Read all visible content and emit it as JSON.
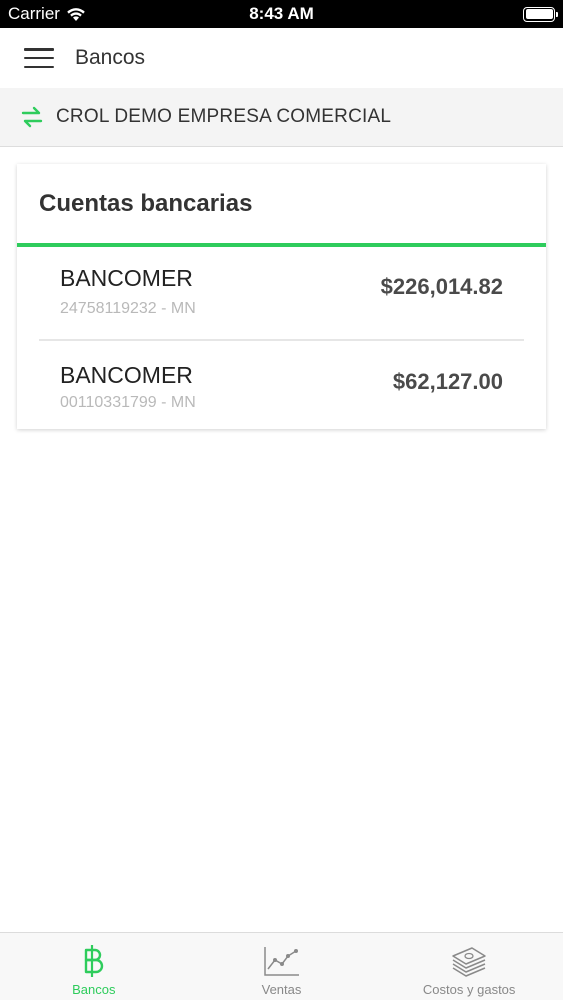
{
  "status_bar": {
    "carrier": "Carrier",
    "time": "8:43 AM"
  },
  "app_bar": {
    "title": "Bancos"
  },
  "company": {
    "name": "CROL DEMO EMPRESA COMERCIAL"
  },
  "card": {
    "title": "Cuentas bancarias",
    "accounts": [
      {
        "bank": "BANCOMER",
        "number": "24758119232 - MN",
        "amount": "$226,014.82"
      },
      {
        "bank": "BANCOMER",
        "number": "00110331799 - MN",
        "amount": "$62,127.00"
      }
    ]
  },
  "tab_bar": {
    "tabs": [
      {
        "label": "Bancos",
        "icon": "baht-icon",
        "active": true
      },
      {
        "label": "Ventas",
        "icon": "line-chart-icon",
        "active": false
      },
      {
        "label": "Costos y gastos",
        "icon": "money-stack-icon",
        "active": false
      }
    ]
  },
  "colors": {
    "accent": "#2ecc5c",
    "status_bar_bg": "#000000"
  }
}
